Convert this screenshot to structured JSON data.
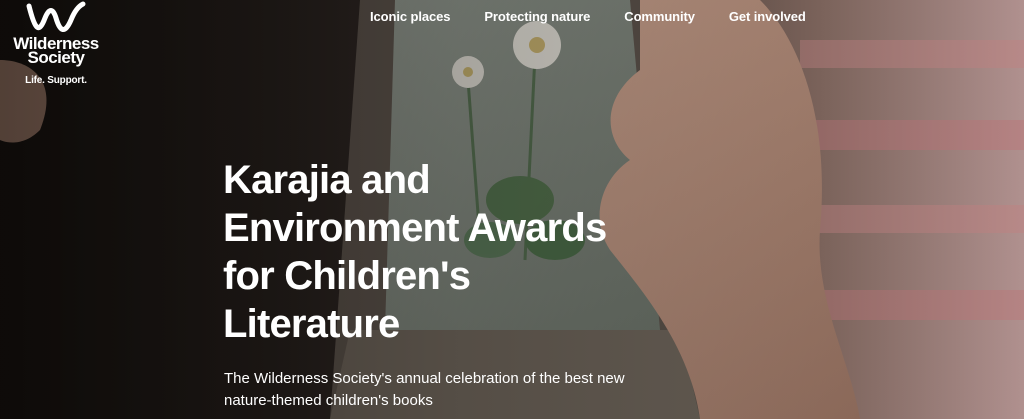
{
  "logo": {
    "icon": "wilderness-society-w-icon",
    "name_line1": "Wilderness",
    "name_line2": "Society",
    "tagline": "Life. Support."
  },
  "nav": {
    "items": [
      {
        "label": "Iconic places"
      },
      {
        "label": "Protecting nature"
      },
      {
        "label": "Community"
      },
      {
        "label": "Get involved"
      }
    ]
  },
  "hero": {
    "title_line1": "Karajia and",
    "title_line2": "Environment Awards",
    "title_line3": "for Children's",
    "title_line4": "Literature",
    "subtitle_line1": "The Wilderness Society's annual celebration of the best new",
    "subtitle_line2": "nature-themed children's books"
  },
  "colors": {
    "text": "#ffffff",
    "background": "#1b1613"
  }
}
